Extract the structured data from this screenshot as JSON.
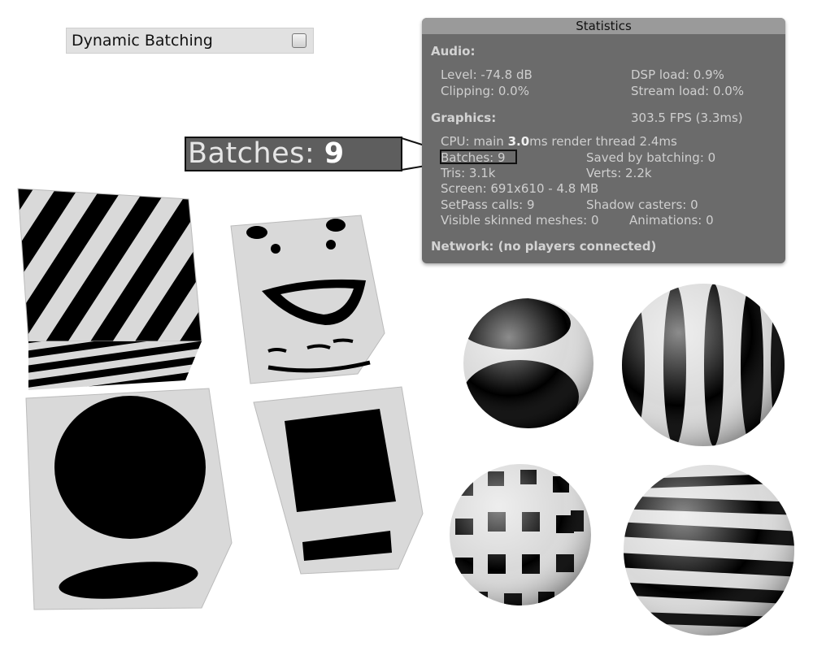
{
  "inspector": {
    "dynamic_batching_label": "Dynamic Batching",
    "dynamic_batching_checked": false
  },
  "stats": {
    "title": "Statistics",
    "audio_header": "Audio:",
    "level": "Level: -74.8 dB",
    "dsp_load": "DSP load: 0.9%",
    "clipping": "Clipping: 0.0%",
    "stream_load": "Stream load: 0.0%",
    "graphics_header": "Graphics:",
    "fps": "303.5 FPS (3.3ms)",
    "cpu_prefix": "CPU: main ",
    "cpu_main": "3.0",
    "cpu_suffix": "ms  render thread 2.4ms",
    "batches": "Batches: 9",
    "saved_by_batching": "Saved by batching: 0",
    "tris": "Tris: 3.1k",
    "verts": "Verts: 2.2k",
    "screen": "Screen: 691x610 - 4.8 MB",
    "setpass": "SetPass calls: 9",
    "shadow_casters": "Shadow casters: 0",
    "visible_skinned": "Visible skinned meshes: 0",
    "animations": "Animations: 0",
    "network": "Network: (no players connected)"
  },
  "callout": {
    "label": "Batches: ",
    "value": "9"
  },
  "scene": {
    "cubes": [
      "diagonal-stripes-cube",
      "smiley-face-cube",
      "circle-cube",
      "square-cube"
    ],
    "spheres": [
      "spot-sphere",
      "vertical-stripe-sphere",
      "checker-sphere",
      "horizontal-stripe-sphere"
    ]
  }
}
